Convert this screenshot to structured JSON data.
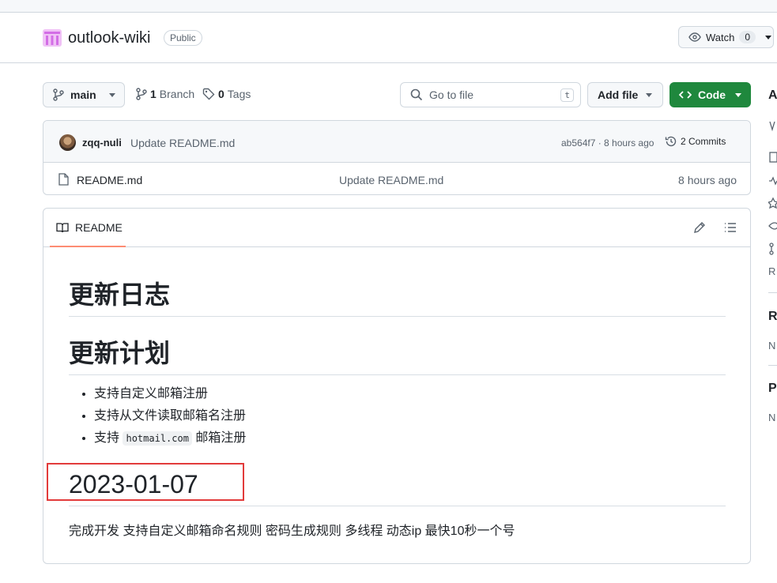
{
  "repo": {
    "name": "outlook-wiki",
    "visibility": "Public",
    "watch_label": "Watch",
    "watch_count": "0"
  },
  "toolbar": {
    "branch": "main",
    "branches_count": "1",
    "branches_label": "Branch",
    "tags_count": "0",
    "tags_label": "Tags",
    "search_placeholder": "Go to file",
    "search_shortcut": "t",
    "add_file_label": "Add file",
    "code_label": "Code"
  },
  "commit": {
    "author": "zqq-nuli",
    "message": "Update README.md",
    "hash_time": "ab564f7 · 8 hours ago",
    "commits_label": "2 Commits"
  },
  "files": [
    {
      "name": "README.md",
      "message": "Update README.md",
      "time": "8 hours ago"
    }
  ],
  "readme": {
    "tab_label": "README",
    "h1_changelog": "更新日志",
    "h1_plan": "更新计划",
    "plan_items": [
      "支持自定义邮箱注册",
      "支持从文件读取邮箱名注册"
    ],
    "plan_item3_prefix": "支持",
    "plan_item3_code": "hotmail.com",
    "plan_item3_suffix": "邮箱注册",
    "h2_date": "2023-01-07",
    "paragraph": "完成开发 支持自定义邮箱命名规则 密码生成规则 多线程 动态ip 最快10秒一个号"
  },
  "sidebar_fragments": {
    "about_initial": "A",
    "readme_initial": "R",
    "releases_initial": "R",
    "releases_none": "N",
    "packages_initial": "P",
    "packages_none": "N"
  },
  "colors": {
    "code_button": "#1f883d",
    "tab_underline": "#fd8c73",
    "highlight_box": "#e23b3b"
  }
}
